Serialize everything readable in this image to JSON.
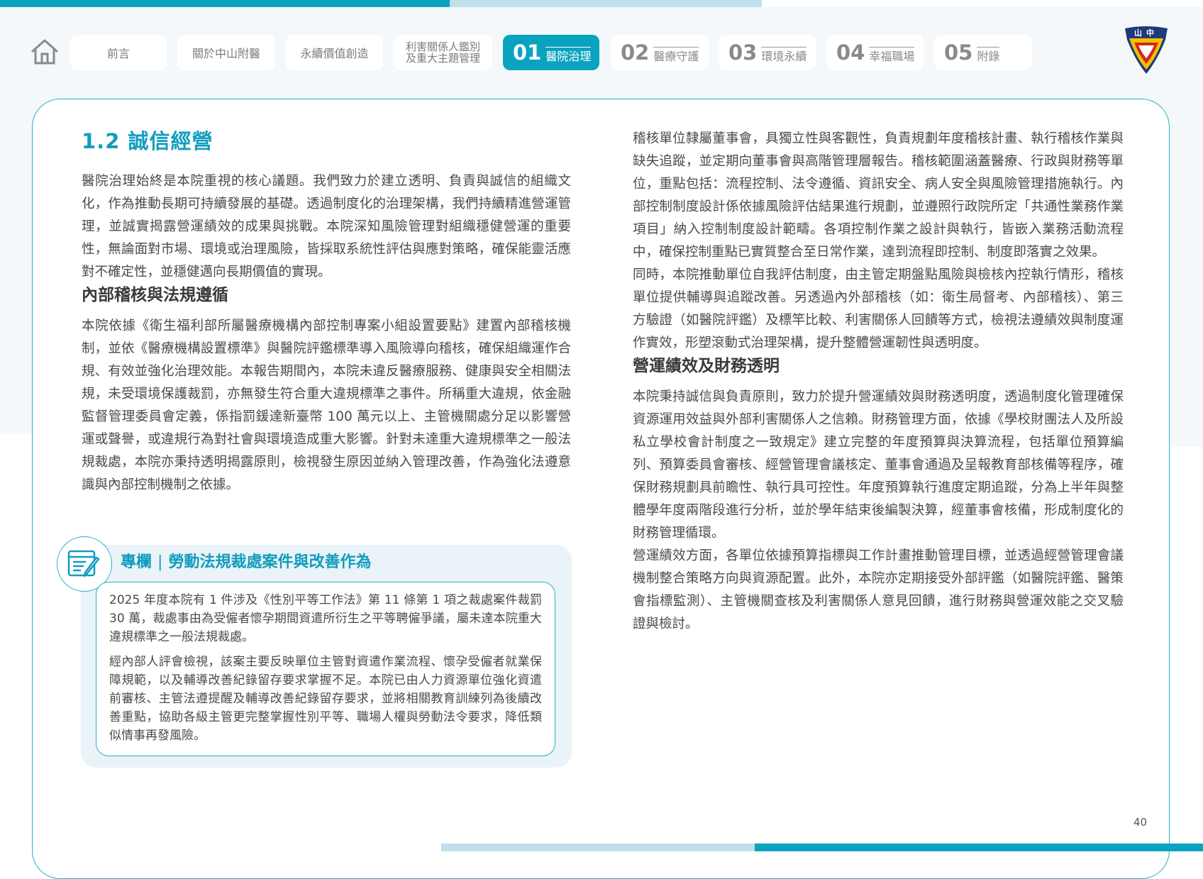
{
  "nav": {
    "tabs": [
      "前言",
      "關於中山附醫",
      "永續價值創造"
    ],
    "stakeholder_tab": {
      "line1": "利害關係人鑑別",
      "line2": "及重大主題管理"
    },
    "chapters": [
      {
        "num": "01",
        "label": "醫院治理"
      },
      {
        "num": "02",
        "label": "醫療守護"
      },
      {
        "num": "03",
        "label": "環境永續"
      },
      {
        "num": "04",
        "label": "幸福職場"
      },
      {
        "num": "05",
        "label": "附錄"
      }
    ],
    "active_chapter": "01",
    "logo_text": "山中"
  },
  "colors": {
    "accent": "#0aa3bf",
    "accent_light": "#bfe0eb",
    "column_bg": "#eaf3f8"
  },
  "left": {
    "section_title": "1.2 誠信經營",
    "intro": "醫院治理始終是本院重視的核心議題。我們致力於建立透明、負責與誠信的組織文化，作為推動長期可持續發展的基礎。透過制度化的治理架構，我們持續精進營運管理，並誠實揭露營運績效的成果與挑戰。本院深知風險管理對組織穩健營運的重要性，無論面對市場、環境或治理風險，皆採取系統性評估與應對策略，確保能靈活應對不確定性，並穩健邁向長期價值的實現。",
    "audit_heading": "內部稽核與法規遵循",
    "audit_text": "本院依據《衛生福利部所屬醫療機構內部控制專案小組設置要點》建置內部稽核機制，並依《醫療機構設置標準》與醫院評鑑標準導入風險導向稽核，確保組織運作合規、有效並強化治理效能。本報告期間內，本院未違反醫療服務、健康與安全相關法規，未受環境保護裁罰，亦無發生符合重大違規標準之事件。所稱重大違規，依金融監督管理委員會定義，係指罰鍰達新臺幣 100 萬元以上、主管機關處分足以影響營運或聲譽，或違規行為對社會與環境造成重大影響。針對未達重大違規標準之一般法規裁處，本院亦秉持透明揭露原則，檢視發生原因並納入管理改善，作為強化法遵意識與內部控制機制之依據。"
  },
  "column": {
    "label": "專欄",
    "title": "勞動法規裁處案件與改善作為",
    "icon": "document-pen-icon",
    "para1": "2025 年度本院有 1 件涉及《性別平等工作法》第 11 條第 1 項之裁處案件裁罰 30 萬，裁處事由為受僱者懷孕期間資遣所衍生之平等聘僱爭議，屬未達本院重大違規標準之一般法規裁處。",
    "para2": "經內部人評會檢視，該案主要反映單位主管對資遣作業流程、懷孕受僱者就業保障規範，以及輔導改善紀錄留存要求掌握不足。本院已由人力資源單位強化資遣前審核、主管法遵提醒及輔導改善紀錄留存要求，並將相關教育訓練列為後續改善重點，協助各級主管更完整掌握性別平等、職場人權與勞動法令要求，降低類似情事再發風險。"
  },
  "right": {
    "audit_cont": "稽核單位隸屬董事會，具獨立性與客觀性，負責規劃年度稽核計畫、執行稽核作業與缺失追蹤，並定期向董事會與高階管理層報告。稽核範圍涵蓋醫療、行政與財務等單位，重點包括：流程控制、法令遵循、資訊安全、病人安全與風險管理措施執行。內部控制制度設計係依據風險評估結果進行規劃，並遵照行政院所定「共通性業務作業項目」納入控制制度設計範疇。各項控制作業之設計與執行，皆嵌入業務活動流程中，確保控制重點已實質整合至日常作業，達到流程即控制、制度即落實之效果。",
    "self_assessment": "同時，本院推動單位自我評估制度，由主管定期盤點風險與檢核內控執行情形，稽核單位提供輔導與追蹤改善。另透過內外部稽核（如：衛生局督考、內部稽核）、第三方驗證（如醫院評鑑）及標竿比較、利害關係人回饋等方式，檢視法遵績效與制度運作實效，形塑滾動式治理架構，提升整體營運韌性與透明度。",
    "finance_heading": "營運績效及財務透明",
    "finance_text": "本院秉持誠信與負責原則，致力於提升營運績效與財務透明度，透過制度化管理確保資源運用效益與外部利害關係人之信賴。財務管理方面，依據《學校財團法人及所設私立學校會計制度之一致規定》建立完整的年度預算與決算流程，包括單位預算編列、預算委員會審核、經營管理會議核定、董事會通過及呈報教育部核備等程序，確保財務規劃具前瞻性、執行具可控性。年度預算執行進度定期追蹤，分為上半年與整體學年度兩階段進行分析，並於學年結束後編製決算，經董事會核備，形成制度化的財務管理循環。",
    "performance_text": "營運績效方面，各單位依據預算指標與工作計畫推動管理目標，並透過經營管理會議機制整合策略方向與資源配置。此外，本院亦定期接受外部評鑑（如醫院評鑑、醫策會指標監測）、主管機關查核及利害關係人意見回饋，進行財務與營運效能之交叉驗證與檢討。"
  },
  "page_number": "40"
}
